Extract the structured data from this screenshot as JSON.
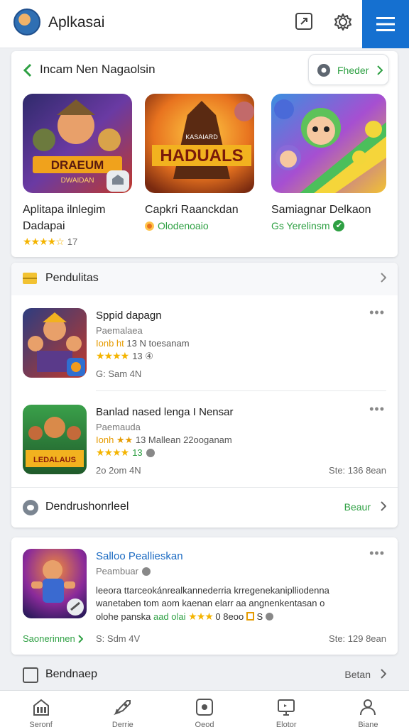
{
  "header": {
    "title": "Aplkasai"
  },
  "featured": {
    "title": "Incam Nen Nagaolsin",
    "filter_label": "Fheder",
    "apps": [
      {
        "name_line1": "Aplitapa ilnlegim",
        "name_line2": "Dadapai",
        "stars": "★★★★☆",
        "rating": "17",
        "art_title": "DRAEUM",
        "art_sub": "DWAIDAN"
      },
      {
        "name_line1": "Capkri Raanckdan",
        "sub": "Olodenoaio",
        "art_title": "HADUALS",
        "art_sub": "KASAIARD"
      },
      {
        "name_line1": "Samiagnar Delkaon",
        "sub": "Gs Yerelinsm"
      }
    ]
  },
  "section2": {
    "title": "Pendulitas",
    "rows": [
      {
        "title": "Sppid dapagn",
        "dev": "Paemalaea",
        "line3_hl": "Ionb ht",
        "line3": "13 N toesanam",
        "stars": "★★★★",
        "rating_text": "13 ④",
        "date": "G: Sam 4N",
        "size": ""
      },
      {
        "title": "Banlad nased lenga I Nensar",
        "dev": "Paemauda",
        "line3_hl": "Ionh ★★",
        "line3": "13 Mallean 22ooganam",
        "stars": "★★★★",
        "rating_text": "13",
        "date": "2o 2om 4N",
        "size": "Ste: 136 8ean",
        "icon_label": "LEDALAUS"
      }
    ],
    "footer_title": "Dendrushonrleel",
    "footer_more": "Beaur"
  },
  "card3": {
    "title": "Salloo Peallieskan",
    "dev": "Peambuar",
    "desc_line1": "leeora ttarceokánrealkannederria krregenekaniplliodenna",
    "desc_line2": "wanetaben tom aom kaenan elarr aa angnenkentasan o",
    "desc_line3_a": "olohe panska",
    "desc_line3_hl": "aad olai",
    "desc_line3_stars": "★★★",
    "desc_line3_b": "0 8eoo",
    "more_link": "Saonerinnen",
    "date": "S: Sdm 4V",
    "size": "Ste: 129 8ean"
  },
  "section4": {
    "title": "Bendnaep",
    "more": "Betan"
  },
  "bottom_nav": [
    {
      "label": "Seronf",
      "icon": "store-icon"
    },
    {
      "label": "Derrie",
      "icon": "rocket-icon"
    },
    {
      "label": "Oeod",
      "icon": "media-icon"
    },
    {
      "label": "Elotor",
      "icon": "tv-icon"
    },
    {
      "label": "Biane",
      "icon": "user-icon"
    }
  ],
  "colors": {
    "accent_blue": "#1570d0",
    "green": "#2ea043",
    "star": "#f4b400",
    "link_blue": "#1c6bc2"
  }
}
